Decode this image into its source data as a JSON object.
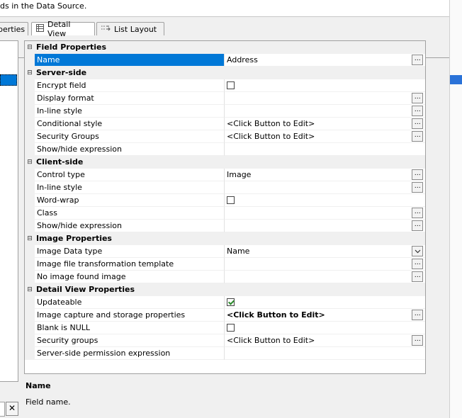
{
  "header": {
    "text": "ds in the Data Source."
  },
  "tabs": [
    {
      "label": "perties"
    },
    {
      "label": "Detail View"
    },
    {
      "label": "List Layout"
    }
  ],
  "grid": {
    "field_properties": {
      "title": "Field Properties",
      "name_label": "Name",
      "name_value": "Address"
    },
    "server_side": {
      "title": "Server-side",
      "encrypt_label": "Encrypt field",
      "display_format_label": "Display format",
      "inline_style_label": "In-line style",
      "conditional_style_label": "Conditional style",
      "conditional_style_value": "<Click Button to Edit>",
      "security_groups_label": "Security Groups",
      "security_groups_value": "<Click Button to Edit>",
      "showhide_label": "Show/hide expression"
    },
    "client_side": {
      "title": "Client-side",
      "control_type_label": "Control type",
      "control_type_value": "Image",
      "inline_style_label": "In-line style",
      "wordwrap_label": "Word-wrap",
      "class_label": "Class",
      "showhide_label": "Show/hide expression"
    },
    "image_properties": {
      "title": "Image Properties",
      "data_type_label": "Image Data type",
      "data_type_value": "Name",
      "transform_label": "Image file transformation template",
      "noimage_label": "No image found image"
    },
    "detail_view": {
      "title": "Detail View Properties",
      "updateable_label": "Updateable",
      "capture_label": "Image capture and storage properties",
      "capture_value": "<Click Button to Edit>",
      "blank_null_label": "Blank is NULL",
      "security_groups_label": "Security groups",
      "security_groups_value": "<Click Button to Edit>",
      "permission_label": "Server-side permission expression"
    },
    "ellipsis": "…"
  },
  "description": {
    "title": "Name",
    "text": "Field name."
  },
  "controls": {
    "close": "✕"
  },
  "icons": {
    "collapse": "⊟",
    "detail_tab": "grid-icon",
    "list_tab": "list-layout-icon"
  },
  "colors": {
    "selection": "#0078d7",
    "category_bg": "#f0f0f0",
    "check": "#2a8a2a"
  }
}
